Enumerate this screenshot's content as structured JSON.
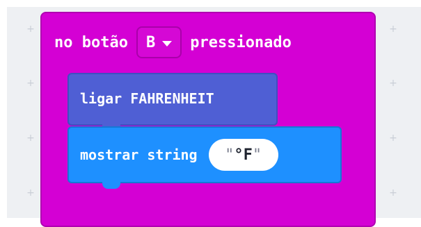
{
  "event_block": {
    "prefix": "no botão",
    "button_value": "B",
    "suffix": "pressionado",
    "color": "#d400d4"
  },
  "commands": [
    {
      "label": "ligar FAHRENHEIT",
      "color": "#4f5fd4"
    },
    {
      "label": "mostrar string",
      "string_value": "°F",
      "color": "#1e90ff"
    }
  ]
}
